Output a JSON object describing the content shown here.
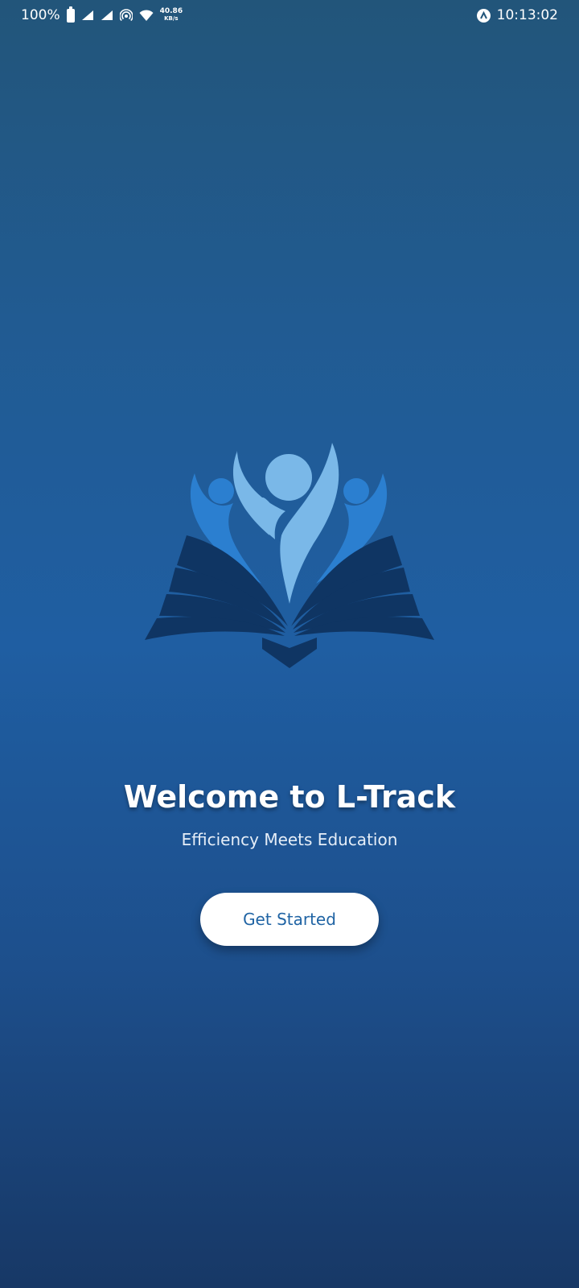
{
  "status_bar": {
    "battery_percent": "100%",
    "net_speed_value": "40.86",
    "net_speed_unit": "KB/s",
    "time": "10:13:02",
    "icons": [
      "battery-icon",
      "signal-icon",
      "signal-icon",
      "hotspot-icon",
      "wifi-icon",
      "app-notification-icon"
    ]
  },
  "logo": {
    "icon": "book-people-logo",
    "colors": {
      "book": "#0f3563",
      "figure_center": "#7ab8e8",
      "figure_sides": "#2b7fd0"
    }
  },
  "welcome": {
    "title": "Welcome to L-Track",
    "tagline": "Efficiency Meets Education"
  },
  "actions": {
    "get_started_label": "Get Started"
  },
  "colors": {
    "background_top": "#22557a",
    "background_mid": "#1f5ea2",
    "background_bottom": "#173866",
    "button_bg": "#ffffff",
    "button_text": "#2064a4"
  }
}
